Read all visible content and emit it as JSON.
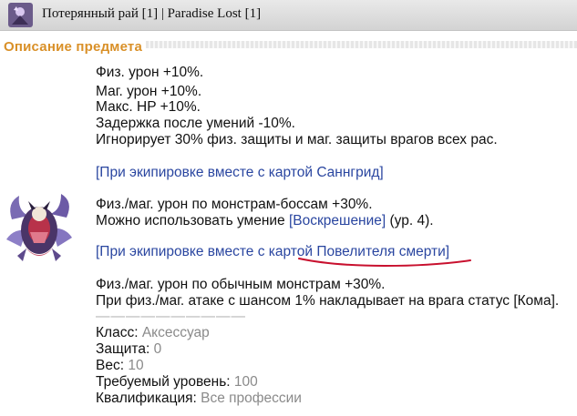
{
  "window": {
    "title": "Потерянный рай [1] | Paradise Lost [1]"
  },
  "section": {
    "title": "Описание предмета"
  },
  "item": {
    "stats": [
      "Физ. урон +10%.",
      "Маг. урон +10%.",
      "Макс. HP +10%.",
      "Задержка после умений -10%.",
      "Игнорирует 30% физ. защиты и маг. защиты врагов всех рас."
    ],
    "combo1": {
      "header": "[При экипировке вместе с картой Саннгрид]",
      "line1": "Физ./маг. урон по монстрам-боссам +30%.",
      "line2_prefix": "Можно использовать умение ",
      "line2_skill": "[Воскрешение]",
      "line2_suffix": " (ур. 4)."
    },
    "combo2": {
      "header_prefix": "[При экипировке вместе с картой ",
      "header_card": "Повелителя смерти]",
      "line1": "Физ./маг. урон по обычным монстрам +30%.",
      "line2": "При физ./маг. атаке с шансом 1% накладывает на врага статус [Кома]."
    },
    "separator": "——————————",
    "properties": {
      "class_label": "Класс: ",
      "class_value": "Аксессуар",
      "defense_label": "Защита: ",
      "defense_value": "0",
      "weight_label": "Вес: ",
      "weight_value": "10",
      "level_label": "Требуемый уровень: ",
      "level_value": "100",
      "qual_label": "Квалификация: ",
      "qual_value": "Все профессии"
    }
  },
  "colors": {
    "header_orange": "#d99028",
    "combo_blue": "#2a46a0",
    "value_gray": "#8a8a8a",
    "annotation_red": "#c8102e"
  }
}
